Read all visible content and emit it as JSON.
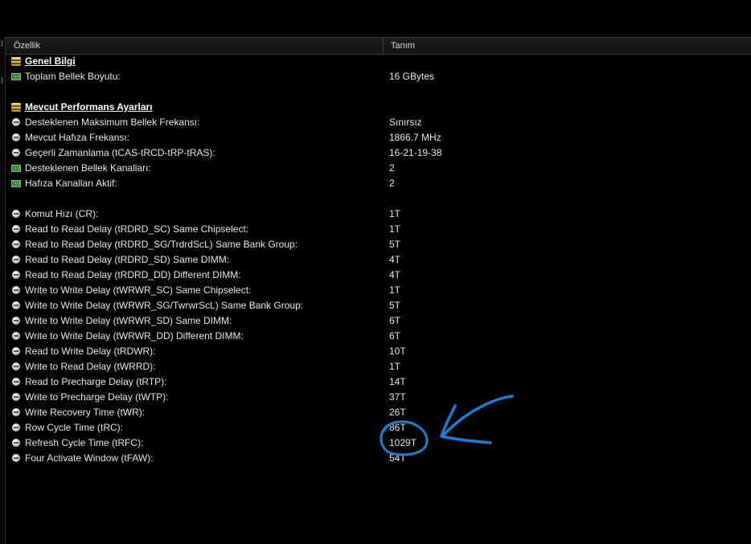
{
  "columns": {
    "property": "Özellik",
    "value": "Tanım"
  },
  "rows": [
    {
      "type": "section",
      "icon": "database-icon",
      "label": "Genel Bilgi",
      "value": ""
    },
    {
      "type": "item",
      "icon": "memory-module-icon",
      "label": "Toplam Bellek Boyutu:",
      "value": "16 GBytes"
    },
    {
      "type": "blank",
      "label": "",
      "value": ""
    },
    {
      "type": "section",
      "icon": "database-icon",
      "label": "Mevcut Performans Ayarları",
      "value": ""
    },
    {
      "type": "item",
      "icon": "clock-icon",
      "label": "Desteklenen Maksimum Bellek Frekansı:",
      "value": "Sınırsız"
    },
    {
      "type": "item",
      "icon": "clock-icon",
      "label": "Mevcut Hafıza Frekansı:",
      "value": "1866.7 MHz"
    },
    {
      "type": "item",
      "icon": "clock-icon",
      "label": "Geçerli Zamanlama (tCAS-tRCD-tRP-tRAS):",
      "value": "16-21-19-38"
    },
    {
      "type": "item",
      "icon": "memory-module-icon",
      "label": "Desteklenen Bellek Kanalları:",
      "value": "2"
    },
    {
      "type": "item",
      "icon": "memory-module-icon",
      "label": "Hafıza Kanalları Aktif:",
      "value": "2"
    },
    {
      "type": "blank",
      "label": "",
      "value": ""
    },
    {
      "type": "item",
      "icon": "clock-icon",
      "label": "Komut Hızı (CR):",
      "value": "1T"
    },
    {
      "type": "item",
      "icon": "clock-icon",
      "label": "Read to Read Delay (tRDRD_SC) Same Chipselect:",
      "value": "1T"
    },
    {
      "type": "item",
      "icon": "clock-icon",
      "label": "Read to Read Delay (tRDRD_SG/TrdrdScL) Same Bank Group:",
      "value": "5T"
    },
    {
      "type": "item",
      "icon": "clock-icon",
      "label": "Read to Read Delay (tRDRD_SD) Same DIMM:",
      "value": "4T"
    },
    {
      "type": "item",
      "icon": "clock-icon",
      "label": "Read to Read Delay (tRDRD_DD) Different DIMM:",
      "value": "4T"
    },
    {
      "type": "item",
      "icon": "clock-icon",
      "label": "Write to Write Delay (tWRWR_SC) Same Chipselect:",
      "value": "1T"
    },
    {
      "type": "item",
      "icon": "clock-icon",
      "label": "Write to Write Delay (tWRWR_SG/TwrwrScL) Same Bank Group:",
      "value": "5T"
    },
    {
      "type": "item",
      "icon": "clock-icon",
      "label": "Write to Write Delay (tWRWR_SD) Same DIMM:",
      "value": "6T"
    },
    {
      "type": "item",
      "icon": "clock-icon",
      "label": "Write to Write Delay (tWRWR_DD) Different DIMM:",
      "value": "6T"
    },
    {
      "type": "item",
      "icon": "clock-icon",
      "label": "Read to Write Delay (tRDWR):",
      "value": "10T"
    },
    {
      "type": "item",
      "icon": "clock-icon",
      "label": "Write to Read Delay (tWRRD):",
      "value": "1T"
    },
    {
      "type": "item",
      "icon": "clock-icon",
      "label": "Read to Precharge Delay (tRTP):",
      "value": "14T"
    },
    {
      "type": "item",
      "icon": "clock-icon",
      "label": "Write to Precharge Delay (tWTP):",
      "value": "37T"
    },
    {
      "type": "item",
      "icon": "clock-icon",
      "label": "Write Recovery Time (tWR):",
      "value": "26T"
    },
    {
      "type": "item",
      "icon": "clock-icon",
      "label": "Row Cycle Time (tRC):",
      "value": "86T"
    },
    {
      "type": "item",
      "icon": "clock-icon",
      "label": "Refresh Cycle Time (tRFC):",
      "value": "1029T"
    },
    {
      "type": "item",
      "icon": "clock-icon",
      "label": "Four Activate Window (tFAW):",
      "value": "54T"
    }
  ],
  "annotation": {
    "color": "#1a7fd4",
    "shape": "arrow-and-circle"
  }
}
